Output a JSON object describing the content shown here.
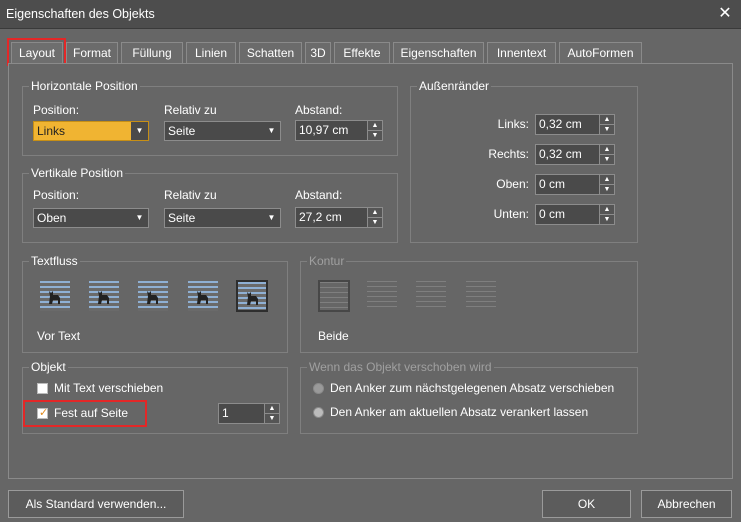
{
  "window": {
    "title": "Eigenschaften des Objekts",
    "close_glyph": "✕"
  },
  "tabs": [
    "Layout",
    "Format",
    "Füllung",
    "Linien",
    "Schatten",
    "3D",
    "Effekte",
    "Eigenschaften",
    "Innentext",
    "AutoFormen"
  ],
  "horizontal": {
    "title": "Horizontale Position",
    "position_label": "Position:",
    "position_value": "Links",
    "relativ_label": "Relativ zu",
    "relativ_value": "Seite",
    "abstand_label": "Abstand:",
    "abstand_value": "10,97 cm"
  },
  "vertical": {
    "title": "Vertikale Position",
    "position_label": "Position:",
    "position_value": "Oben",
    "relativ_label": "Relativ zu",
    "relativ_value": "Seite",
    "abstand_label": "Abstand:",
    "abstand_value": "27,2 cm"
  },
  "margins": {
    "title": "Außenränder",
    "links_label": "Links:",
    "links_value": "0,32 cm",
    "rechts_label": "Rechts:",
    "rechts_value": "0,32 cm",
    "oben_label": "Oben:",
    "oben_value": "0 cm",
    "unten_label": "Unten:",
    "unten_value": "0 cm"
  },
  "textfluss": {
    "title": "Textfluss",
    "caption": "Vor Text",
    "icons": [
      "wrap-square-icon",
      "wrap-tight-icon",
      "wrap-through-icon",
      "wrap-top-bottom-icon",
      "wrap-in-front-icon"
    ]
  },
  "kontur": {
    "title": "Kontur",
    "caption": "Beide"
  },
  "objekt": {
    "title": "Objekt",
    "mit_text": "Mit Text verschieben",
    "fest_auf_seite": "Fest auf Seite",
    "page_value": "1"
  },
  "anker": {
    "title": "Wenn das Objekt verschoben wird",
    "option1": "Den Anker zum nächstgelegenen Absatz verschieben",
    "option2": "Den Anker am aktuellen Absatz verankert lassen"
  },
  "buttons": {
    "standard": "Als Standard verwenden...",
    "ok": "OK",
    "cancel": "Abbrechen"
  },
  "colors": {
    "highlight": "#f0b432",
    "annotation": "#e32727",
    "wrap_lines": "#8fb0d4"
  }
}
